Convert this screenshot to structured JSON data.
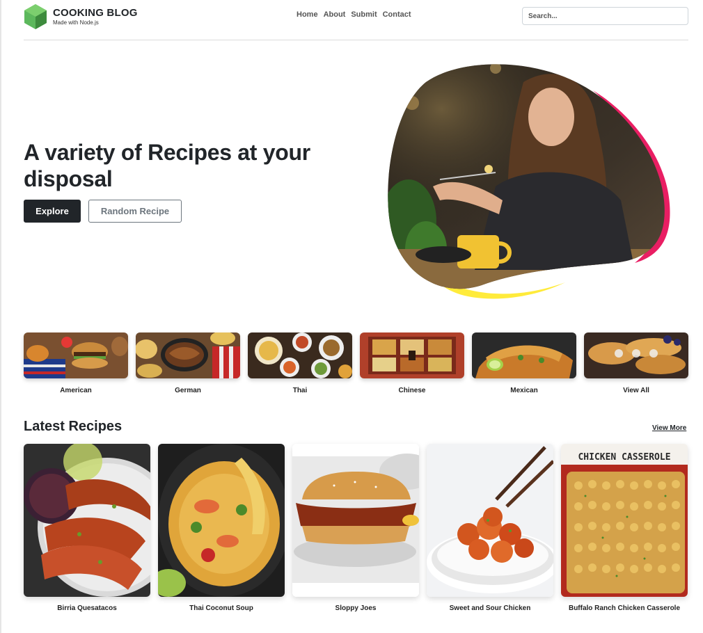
{
  "brand": {
    "title": "COOKING BLOG",
    "subtitle": "Made with Node.js",
    "logo_icon": "hexagon-logo-icon",
    "logo_color": "#5cb85c"
  },
  "nav": {
    "items": [
      {
        "label": "Home"
      },
      {
        "label": "About"
      },
      {
        "label": "Submit"
      },
      {
        "label": "Contact"
      }
    ]
  },
  "search": {
    "placeholder": "Search..."
  },
  "hero": {
    "title": "A variety of Recipes at your disposal",
    "explore_label": "Explore",
    "random_label": "Random Recipe",
    "accent_pink": "#e91e63",
    "accent_yellow": "#ffeb3b"
  },
  "categories": [
    {
      "label": "American"
    },
    {
      "label": "German"
    },
    {
      "label": "Thai"
    },
    {
      "label": "Chinese"
    },
    {
      "label": "Mexican"
    },
    {
      "label": "View All"
    }
  ],
  "latest": {
    "title": "Latest Recipes",
    "view_more": "View More",
    "recipes": [
      {
        "label": "Birria Quesatacos"
      },
      {
        "label": "Thai Coconut Soup"
      },
      {
        "label": "Sloppy Joes"
      },
      {
        "label": "Sweet and Sour Chicken"
      },
      {
        "label": "Buffalo Ranch Chicken Casserole",
        "image_text": "CHICKEN CASSEROLE"
      }
    ]
  }
}
